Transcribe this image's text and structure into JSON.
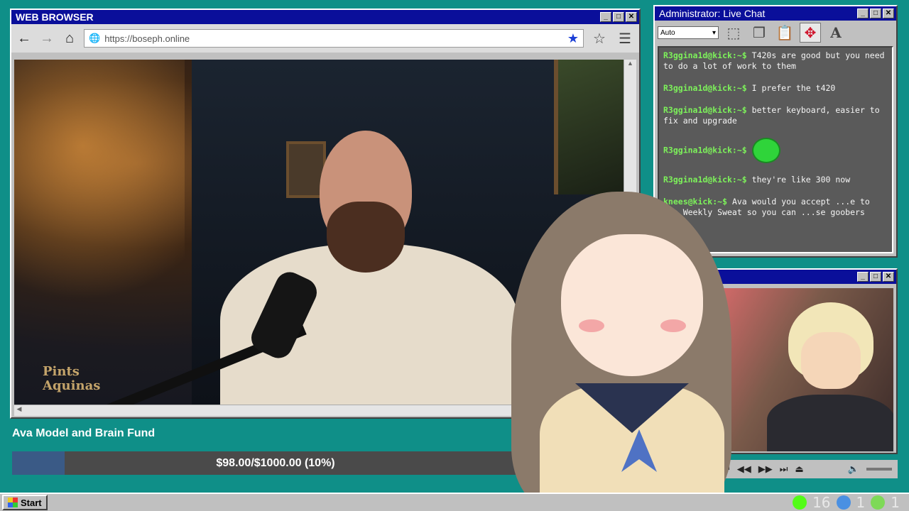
{
  "browser": {
    "title": "WEB BROWSER",
    "url": "https://boseph.online",
    "win_btns": [
      "_",
      "□",
      "✕"
    ],
    "nav": {
      "back": "←",
      "forward": "→",
      "home": "⌂"
    },
    "watermark": "Pints with Aquinas"
  },
  "chat": {
    "title": "Administrator: Live Chat",
    "font_select": "Auto",
    "messages": [
      {
        "user": "R3ggina1d@kick:~$",
        "text": "T420s are good but you need to do a lot of work to them"
      },
      {
        "user": "R3ggina1d@kick:~$",
        "text": "I prefer the t420"
      },
      {
        "user": "R3ggina1d@kick:~$",
        "text": "better keyboard, easier to fix and upgrade"
      },
      {
        "user": "R3ggina1d@kick:~$",
        "text": ""
      },
      {
        "user": "R3ggina1d@kick:~$",
        "text": "they're like 300 now"
      },
      {
        "user": "knees@kick:~$",
        "text": "Ava would you accept ...e to the Weekly Sweat so you can ...se goobers"
      }
    ]
  },
  "fund": {
    "title": "Ava Model and Brain Fund",
    "label": "$98.00/$1000.00 (10%)",
    "progress": 0.1
  },
  "taskbar": {
    "start_label": "Start",
    "tray": [
      {
        "icon": "kick-icon",
        "count": "16",
        "color": "#53fc18"
      },
      {
        "icon": "moon-icon",
        "count": "1",
        "color": "#4a90e2"
      },
      {
        "icon": "play-icon",
        "count": "1",
        "color": "#7ed957"
      }
    ]
  }
}
